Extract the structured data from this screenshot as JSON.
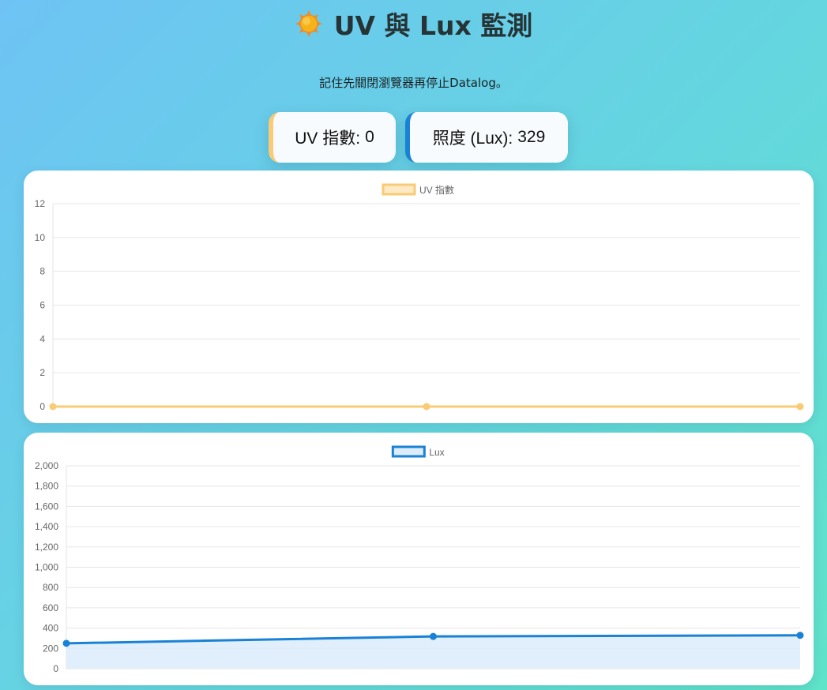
{
  "header": {
    "title": "UV 與 Lux 監測",
    "icon": "sun-icon",
    "subtitle": "記住先關閉瀏覽器再停止Datalog。"
  },
  "cards": {
    "uv_label": "UV 指數:",
    "uv_value": "0",
    "lux_label": "照度 (Lux):",
    "lux_value": "329"
  },
  "colors": {
    "uv_line": "#f8cb74",
    "uv_fill": "#fde9c4",
    "lux_line": "#1a82d4",
    "lux_fill": "#dcecfb"
  },
  "chart_data": [
    {
      "type": "line",
      "legend": "top-center",
      "grid": true,
      "x": [
        "",
        "",
        ""
      ],
      "series": [
        {
          "name": "UV 指數",
          "values": [
            0,
            0,
            0
          ]
        }
      ],
      "ylim": [
        0,
        12
      ],
      "yticks": [
        0,
        2,
        4,
        6,
        8,
        10,
        12
      ],
      "ytick_labels": [
        "0",
        "2",
        "4",
        "6",
        "8",
        "10",
        "12"
      ]
    },
    {
      "type": "area",
      "legend": "top-center",
      "grid": true,
      "x": [
        "",
        "",
        ""
      ],
      "series": [
        {
          "name": "Lux",
          "values": [
            250,
            318,
            329
          ]
        }
      ],
      "ylim": [
        0,
        2000
      ],
      "yticks": [
        0,
        200,
        400,
        600,
        800,
        1000,
        1200,
        1400,
        1600,
        1800,
        2000
      ],
      "ytick_labels": [
        "0",
        "200",
        "400",
        "600",
        "800",
        "1,000",
        "1,200",
        "1,400",
        "1,600",
        "1,800",
        "2,000"
      ]
    }
  ]
}
